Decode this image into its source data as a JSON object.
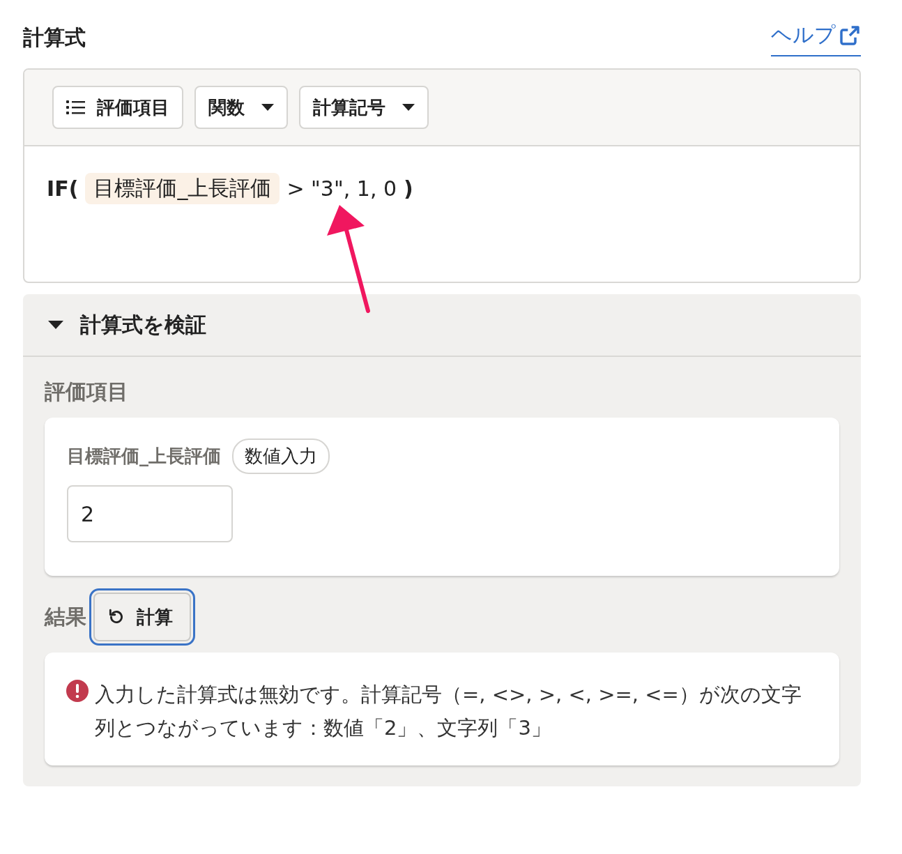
{
  "title": "計算式",
  "help_link": {
    "label": "ヘルプ"
  },
  "toolbar": [
    {
      "label": "評価項目",
      "kind": "list"
    },
    {
      "label": "関数",
      "kind": "dropdown"
    },
    {
      "label": "計算記号",
      "kind": "dropdown"
    }
  ],
  "formula": [
    {
      "kind": "function",
      "text": "IF("
    },
    {
      "kind": "field",
      "text": "目標評価_上長評価"
    },
    {
      "kind": "text",
      "text": "> \"3\", 1, 0"
    },
    {
      "kind": "function",
      "text": ")"
    }
  ],
  "validation": {
    "title": "計算式を検証",
    "expanded": true,
    "items_heading": "評価項目",
    "items": [
      {
        "label": "目標評価_上長評価",
        "tag": "数値入力",
        "value": "2"
      }
    ],
    "result_label": "結果",
    "calculate_button": {
      "label": "計算",
      "focused": true
    },
    "result": {
      "kind": "error",
      "message": "入力した計算式は無効です。計算記号（=, <>, >, <, >=, <=）が次の文字列とつながっています：数値「2」、文字列「3」"
    }
  }
}
